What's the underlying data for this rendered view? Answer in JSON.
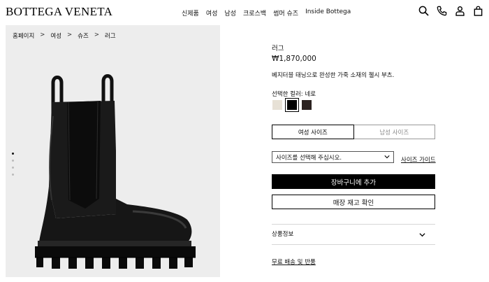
{
  "brand": {
    "logo": "BOTTEGA VENETA"
  },
  "nav": {
    "items": [
      "신제품",
      "여성",
      "남성",
      "크로스백",
      "썸머 슈즈",
      "Inside Bottega"
    ]
  },
  "header_icons": [
    "search-icon",
    "phone-icon",
    "user-icon",
    "bag-icon"
  ],
  "breadcrumb": [
    "홈페이지",
    "여성",
    "슈즈",
    "러그"
  ],
  "gallery": {
    "total_images": 5,
    "active_index": 1
  },
  "product": {
    "name": "러그",
    "price": "₩1,870,000",
    "description": "베지터블 태닝으로 완성한 가죽 소재의 첼시 부츠.",
    "color_label": "선택한 컬러: 네로",
    "colors": [
      {
        "name": "cream",
        "hex": "#e7e1d6"
      },
      {
        "name": "네로",
        "hex": "#000000",
        "selected": true
      },
      {
        "name": "dark-brown",
        "hex": "#2b2220"
      }
    ]
  },
  "size": {
    "tabs": [
      "여성 사이즈",
      "남성 사이즈"
    ],
    "active_tab": "여성 사이즈",
    "select_placeholder": "사이즈를 선택해 주십시오.",
    "guide_label": "사이즈 가이드"
  },
  "actions": {
    "add_to_cart": "장바구니에 추가",
    "check_store": "매장 재고 확인"
  },
  "info": {
    "product_info_label": "상품정보"
  },
  "shipping_label": "무료 배송 및 반품"
}
